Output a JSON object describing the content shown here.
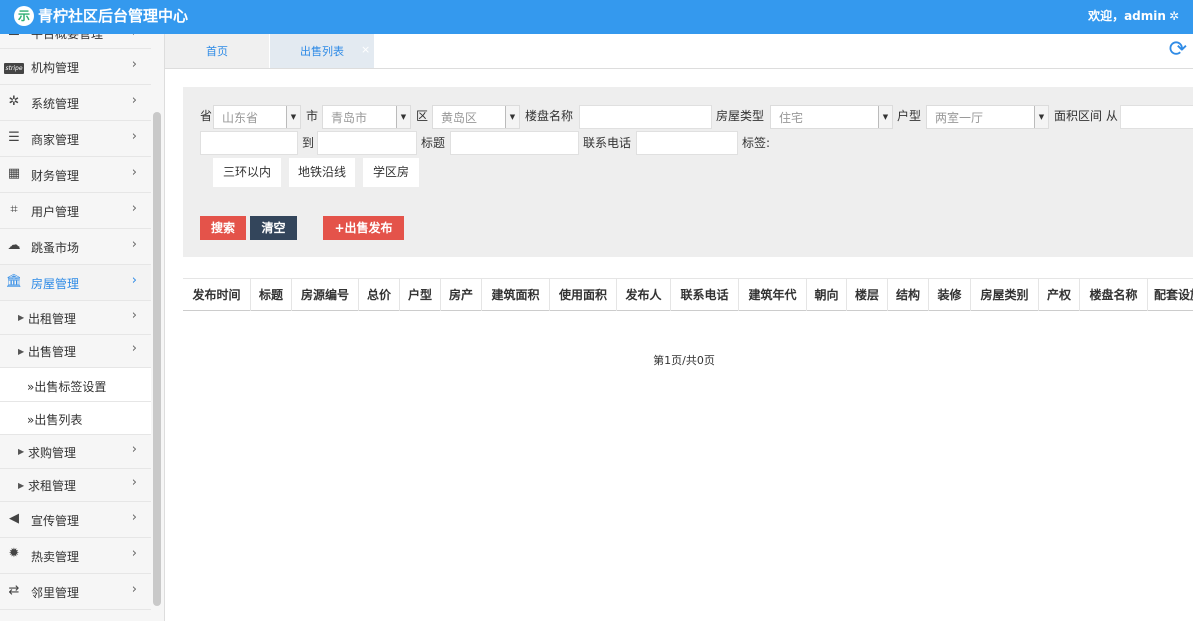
{
  "header": {
    "logo_glyph": "示",
    "title": "青柠社区后台管理中心",
    "welcome": "欢迎，admin",
    "settings_icon": "gear-icon"
  },
  "sidebar": {
    "items": [
      {
        "label": "平台概要管理",
        "icon": "monitor-icon"
      },
      {
        "label": "机构管理",
        "icon": "stripe-icon",
        "icon_text": "stripe"
      },
      {
        "label": "系统管理",
        "icon": "spokes-icon"
      },
      {
        "label": "商家管理",
        "icon": "menu-lines-icon"
      },
      {
        "label": "财务管理",
        "icon": "calculator-icon"
      },
      {
        "label": "用户管理",
        "icon": "crop-icon"
      },
      {
        "label": "跳蚤市场",
        "icon": "cloud-icon"
      },
      {
        "label": "房屋管理",
        "icon": "bank-icon",
        "active": true
      }
    ],
    "house_children": [
      {
        "label": "出租管理"
      },
      {
        "label": "出售管理"
      }
    ],
    "sale_children": [
      {
        "label": "»出售标签设置"
      },
      {
        "label": "»出售列表"
      }
    ],
    "house_children_after": [
      {
        "label": "求购管理"
      },
      {
        "label": "求租管理"
      }
    ],
    "items_after": [
      {
        "label": "宣传管理",
        "icon": "volume-icon"
      },
      {
        "label": "热卖管理",
        "icon": "sun-icon"
      },
      {
        "label": "邻里管理",
        "icon": "retweet-icon"
      }
    ]
  },
  "tabs": [
    {
      "label": "首页"
    },
    {
      "label": "出售列表",
      "active": true
    }
  ],
  "filter": {
    "province_label": "省",
    "province_value": "山东省",
    "city_label": "市",
    "city_value": "青岛市",
    "district_label": "区",
    "district_value": "黄岛区",
    "building_label": "楼盘名称",
    "building_value": "",
    "house_type_label": "房屋类型",
    "house_type_value": "住宅",
    "layout_label": "户型",
    "layout_value": "两室一厅",
    "area_label": "面积区间 从",
    "area_from": "",
    "area_to_label": "到",
    "area_to": "",
    "title_label": "标题",
    "title_value": "",
    "phone_label": "联系电话",
    "phone_value": "",
    "tags_label": "标签:",
    "tags": [
      "三环以内",
      "地铁沿线",
      "学区房"
    ],
    "search_button": "搜索",
    "clear_button": "清空",
    "publish_button": "+出售发布"
  },
  "table": {
    "columns": [
      "发布时间",
      "标题",
      "房源编号",
      "总价",
      "户型",
      "房产",
      "建筑面积",
      "使用面积",
      "发布人",
      "联系电话",
      "建筑年代",
      "朝向",
      "楼层",
      "结构",
      "装修",
      "房屋类别",
      "产权",
      "楼盘名称",
      "配套设施"
    ]
  },
  "pager": {
    "text": "第1页/共0页"
  },
  "colors": {
    "header": "#3499ee",
    "accent": "#2f8be6",
    "danger": "#e4534a",
    "dark": "#33455b"
  }
}
